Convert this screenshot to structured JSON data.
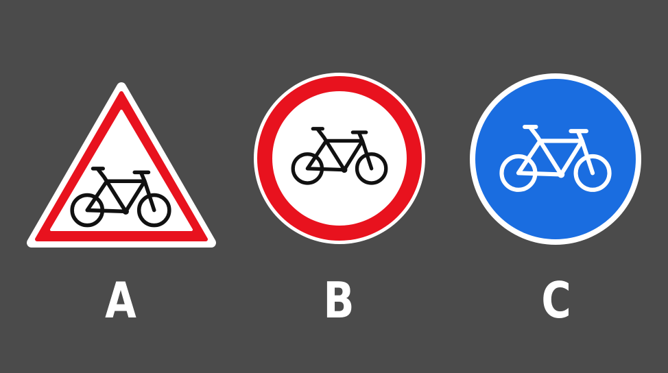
{
  "colors": {
    "background": "#4b4b4b",
    "sign_red": "#e8121e",
    "sign_blue": "#1a6de0",
    "sign_white": "#ffffff",
    "bicycle_black": "#111111",
    "label_white": "#ffffff"
  },
  "signs": [
    {
      "label": "A",
      "shape": "triangle",
      "border_color": "#e8121e",
      "fill_color": "#ffffff",
      "icon": "bicycle-icon",
      "icon_color": "#111111"
    },
    {
      "label": "B",
      "shape": "circle",
      "border_color": "#e8121e",
      "fill_color": "#ffffff",
      "icon": "bicycle-icon",
      "icon_color": "#111111"
    },
    {
      "label": "C",
      "shape": "circle",
      "border_color": "#ffffff",
      "fill_color": "#1a6de0",
      "icon": "bicycle-icon",
      "icon_color": "#ffffff"
    }
  ]
}
